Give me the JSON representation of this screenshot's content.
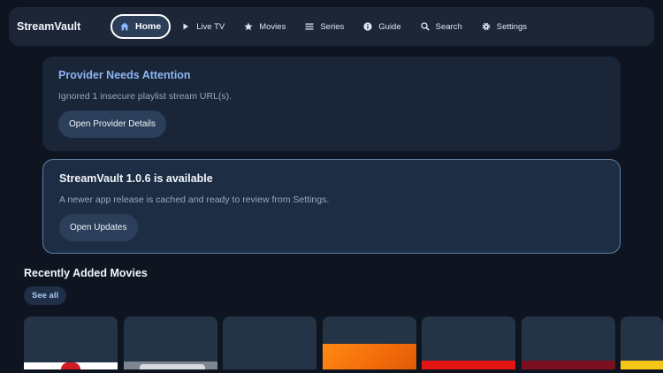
{
  "app": {
    "name": "StreamVault"
  },
  "nav": {
    "items": [
      {
        "label": "Home",
        "icon": "home-icon",
        "active": true
      },
      {
        "label": "Live TV",
        "icon": "play-icon"
      },
      {
        "label": "Movies",
        "icon": "star-icon"
      },
      {
        "label": "Series",
        "icon": "list-icon"
      },
      {
        "label": "Guide",
        "icon": "info-icon"
      },
      {
        "label": "Search",
        "icon": "search-icon"
      },
      {
        "label": "Settings",
        "icon": "gear-icon"
      }
    ]
  },
  "provider_notice": {
    "title": "Provider Needs Attention",
    "message": "Ignored 1 insecure playlist stream URL(s).",
    "button": "Open Provider Details"
  },
  "update_notice": {
    "title": "StreamVault 1.0.6 is available",
    "message": "A newer app release is cached and ready to review from Settings.",
    "button": "Open Updates"
  },
  "recently_added": {
    "title": "Recently Added Movies",
    "see_all": "See all",
    "posters": [
      {
        "art": "white-red"
      },
      {
        "art": "grey-logo"
      },
      {
        "art": "none"
      },
      {
        "art": "orange"
      },
      {
        "art": "red"
      },
      {
        "art": "maroon"
      },
      {
        "art": "yellow"
      }
    ]
  },
  "colors": {
    "background": "#0e1520",
    "accent": "#8cb6f2",
    "card": "#1a2638",
    "button": "#2c3f5a"
  }
}
